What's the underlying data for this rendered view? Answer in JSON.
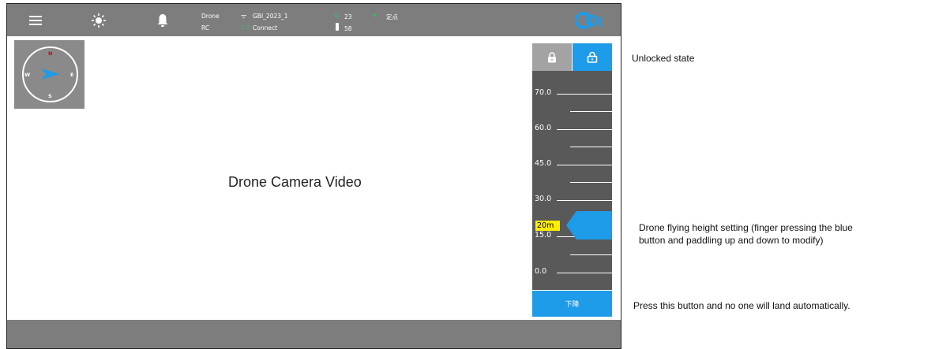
{
  "topbar": {
    "drone_label": "Drone",
    "rc_label": "RC",
    "wifi_name": "GBI_2023_1",
    "connect_status": "Connect",
    "satellites": "23",
    "battery": "58",
    "flight_mode": "定点",
    "logo": "Gbi",
    "icons": [
      "menu-icon",
      "brightness-icon",
      "bell-icon",
      "wifi-icon",
      "link-icon",
      "satellite-icon",
      "battery-icon",
      "drone-mode-icon"
    ]
  },
  "compass": {
    "n": "N",
    "s": "S",
    "e": "E",
    "w": "W",
    "heading_color": "#1e9be9",
    "north_color": "#d0021b"
  },
  "video": {
    "label": "Drone Camera Video"
  },
  "height_panel": {
    "ticks": [
      "70.0",
      "60.0",
      "45.0",
      "30.0",
      "15.0",
      "0.0"
    ],
    "current_height": "20m",
    "land_button": "下降",
    "accent_color": "#1e9be9"
  },
  "annotations": {
    "unlock": "Unlocked state",
    "height_line1": "Drone flying height setting (finger pressing the blue",
    "height_line2": "button and paddling up and down to modify)",
    "land": "Press this button and no one will land automatically."
  }
}
